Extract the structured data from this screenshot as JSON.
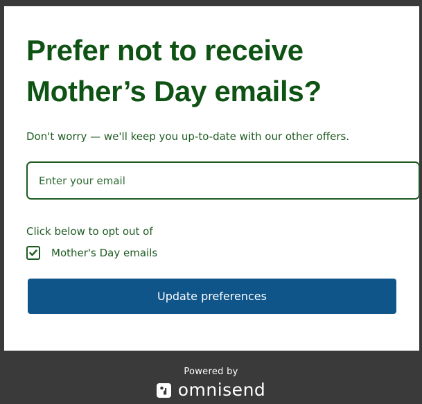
{
  "popup": {
    "title": "Prefer not to receive Mother’s Day emails?",
    "subtitle": "Don't worry — we'll keep you up-to-date with our other offers.",
    "email": {
      "value": "",
      "placeholder": "Enter your email"
    },
    "optout_label": "Click below to opt out of",
    "checkbox": {
      "label": "Mother's Day emails",
      "checked": true
    },
    "submit_label": "Update preferences"
  },
  "footer": {
    "powered_by": "Powered by",
    "brand": "omnisend",
    "brand_icon": "omnisend-logo-icon"
  },
  "colors": {
    "background": "#3a3a3a",
    "card": "#ffffff",
    "accent_green": "#0f5314",
    "text_green": "#1d5a21",
    "button_blue": "#0f5589"
  }
}
